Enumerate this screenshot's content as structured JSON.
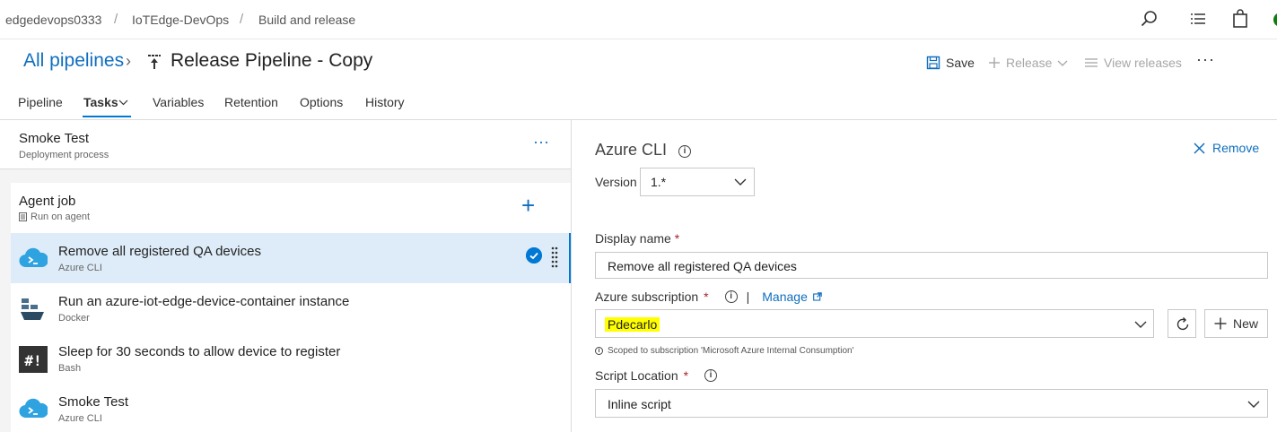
{
  "breadcrumb": {
    "org": "edgedevops0333",
    "project": "IoTEdge-DevOps",
    "section": "Build and release",
    "separator": "/"
  },
  "header": {
    "all_pipelines": "All pipelines",
    "chevron": "›",
    "title": "Release Pipeline - Copy",
    "save_label": "Save",
    "release_label": "Release",
    "view_releases_label": "View releases",
    "more_label": "···"
  },
  "tabs": [
    {
      "label": "Pipeline"
    },
    {
      "label": "Tasks"
    },
    {
      "label": "Variables"
    },
    {
      "label": "Retention"
    },
    {
      "label": "Options"
    },
    {
      "label": "History"
    }
  ],
  "stage": {
    "title": "Smoke Test",
    "subtitle": "Deployment process",
    "more": "···"
  },
  "agent_job": {
    "title": "Agent job",
    "subtitle": "Run on agent",
    "add": "+"
  },
  "tasks": [
    {
      "title": "Remove all registered QA devices",
      "subtitle": "Azure CLI",
      "icon": "azure-cli-icon",
      "selected": true
    },
    {
      "title": "Run an azure-iot-edge-device-container instance",
      "subtitle": "Docker",
      "icon": "docker-icon",
      "selected": false
    },
    {
      "title": "Sleep for 30 seconds to allow device to register",
      "subtitle": "Bash",
      "icon": "bash-icon",
      "selected": false
    },
    {
      "title": "Smoke Test",
      "subtitle": "Azure CLI",
      "icon": "azure-cli-icon",
      "selected": false
    }
  ],
  "detail": {
    "task_name": "Azure CLI",
    "remove_label": "Remove",
    "version_label": "Version",
    "version_value": "1.*",
    "display_name_label": "Display name",
    "required_mark": "*",
    "display_name_value": "Remove all registered QA devices",
    "subscription_label": "Azure subscription",
    "divider": "|",
    "manage_label": "Manage",
    "subscription_value": "Pdecarlo",
    "new_label": "New",
    "scope_note": "Scoped to subscription 'Microsoft Azure Internal Consumption'",
    "script_location_label": "Script Location",
    "script_location_value": "Inline script"
  },
  "colors": {
    "accent": "#0078d4",
    "link": "#106ebe",
    "highlight": "#ffff00",
    "selected_row": "#deecf9"
  }
}
